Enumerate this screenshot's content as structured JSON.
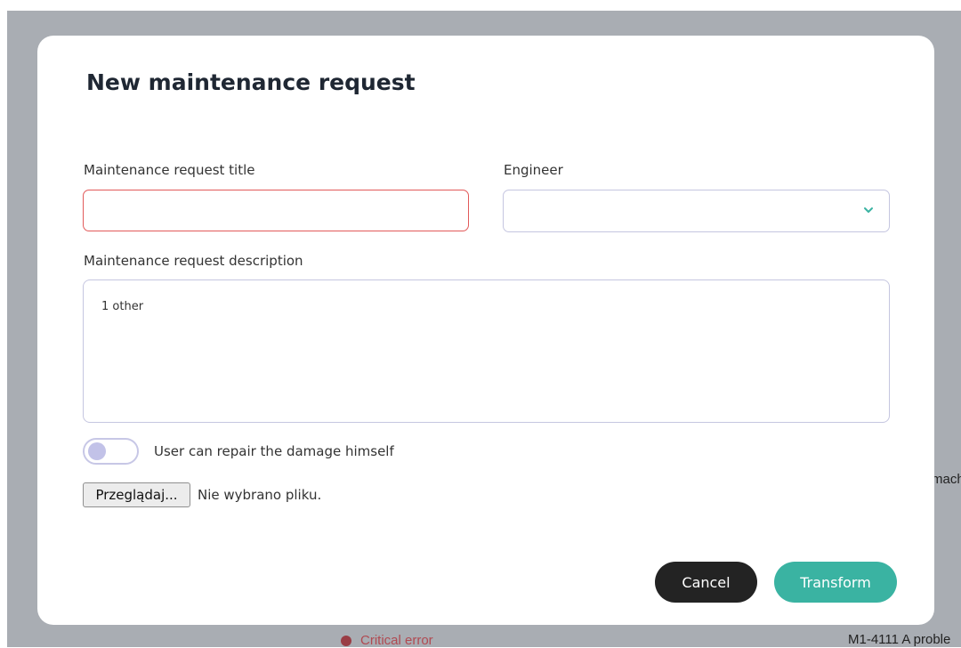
{
  "background": {
    "right_text_top": "mach",
    "right_text_bottom": "M1-4111 A proble",
    "status_label": "Critical error",
    "status_color": "#9a3d45"
  },
  "modal": {
    "title": "New maintenance request",
    "fields": {
      "title_label": "Maintenance request title",
      "title_value": "",
      "engineer_label": "Engineer",
      "engineer_value": "",
      "description_label": "Maintenance request description",
      "description_value": "1 other"
    },
    "toggle": {
      "label": "User can repair the damage himself",
      "checked": false
    },
    "file": {
      "button_label": "Przeglądaj...",
      "status": "Nie wybrano pliku."
    },
    "buttons": {
      "cancel": "Cancel",
      "transform": "Transform"
    }
  },
  "colors": {
    "accent": "#3ab3a2",
    "dark_button": "#232323",
    "error_border": "#e25a5a",
    "input_border": "#c5c6e0",
    "backdrop": "#a9adb3"
  },
  "icons": {
    "select_chevron": "chevron-down-icon",
    "status_dot": "dot-icon"
  }
}
